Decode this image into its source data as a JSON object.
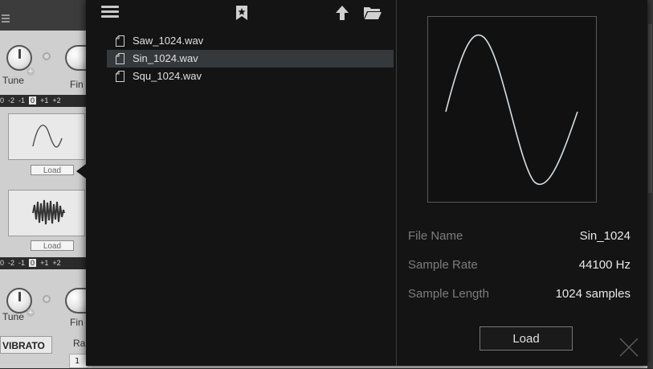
{
  "background": {
    "knob_labels": {
      "tune_top": "Tune",
      "fine_top": "Fin",
      "tune_bottom": "Tune",
      "fine_bottom": "Fin"
    },
    "semitone_row": {
      "values": [
        "0",
        "-2",
        "-1",
        "0",
        "+1",
        "+2"
      ],
      "selected": "0"
    },
    "load_label_1": "Load",
    "load_label_2": "Load",
    "vibrato_tab": "VIBRATO",
    "rate_label": "Ra",
    "rate_value": "1"
  },
  "browser": {
    "files": [
      {
        "name": "Saw_1024.wav",
        "selected": false
      },
      {
        "name": "Sin_1024.wav",
        "selected": true
      },
      {
        "name": "Squ_1024.wav",
        "selected": false
      }
    ],
    "info": {
      "file_name_label": "File Name",
      "file_name_value": "Sin_1024",
      "sample_rate_label": "Sample Rate",
      "sample_rate_value": "44100 Hz",
      "sample_length_label": "Sample Length",
      "sample_length_value": "1024 samples"
    },
    "load_button": "Load"
  },
  "icons": {
    "toolbar": [
      "menu-icon",
      "bookmark-star-icon",
      "up-arrow-icon",
      "folder-icon"
    ],
    "file": "document-icon",
    "close": "close-icon"
  },
  "colors": {
    "popup_bg": "#141414",
    "selection_bg": "#35393c",
    "waveform": "#cfd8e0"
  }
}
